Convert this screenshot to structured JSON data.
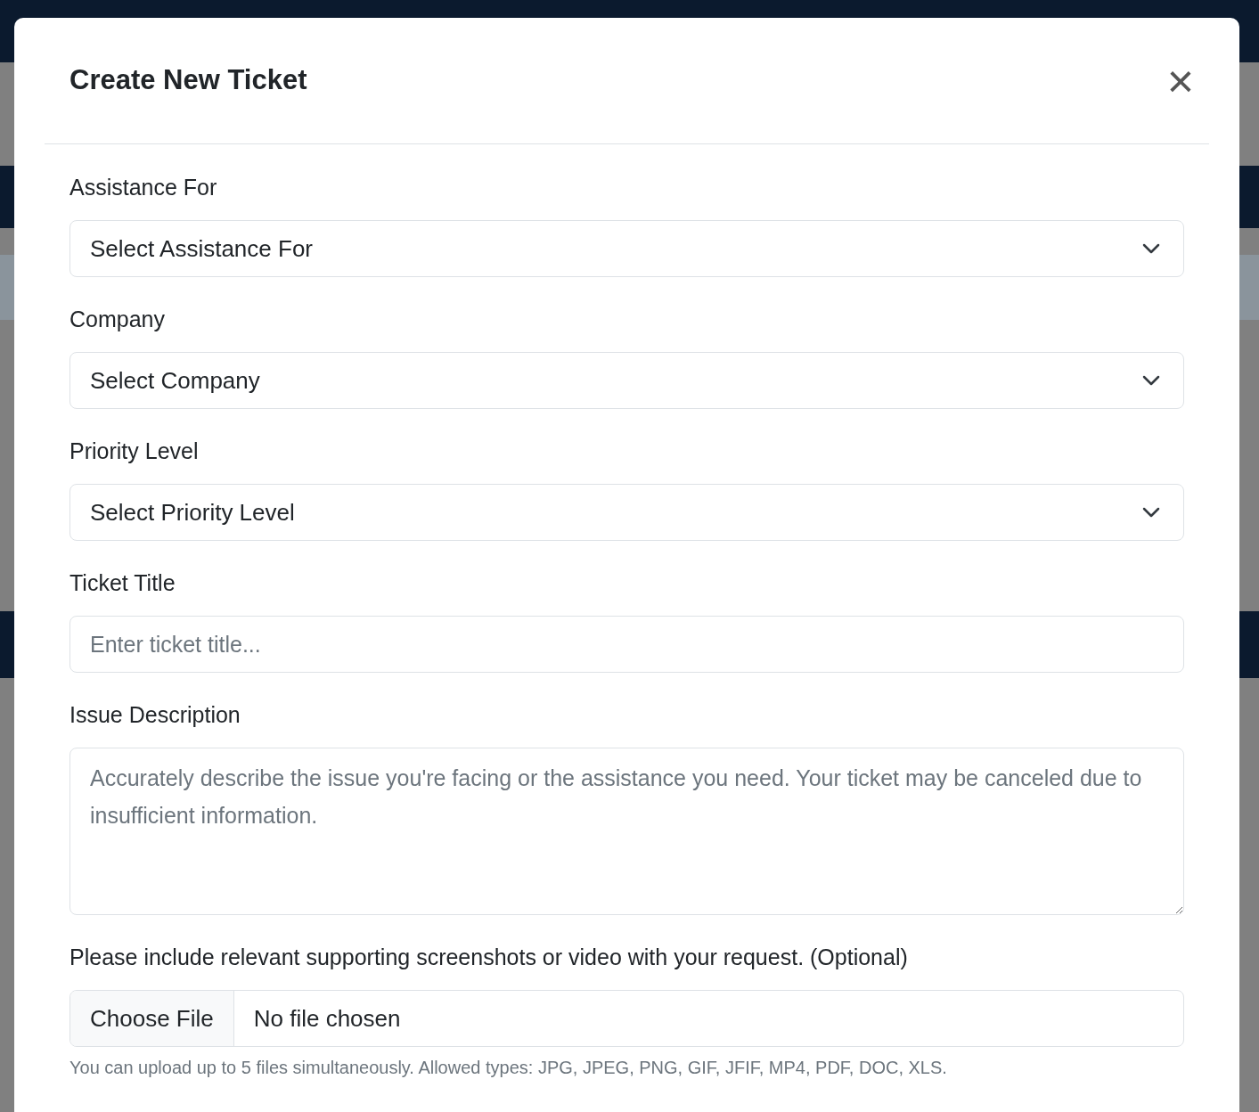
{
  "modal": {
    "title": "Create New Ticket",
    "close_icon": "×"
  },
  "fields": [
    {
      "kind": "select",
      "label": "Assistance For",
      "value": "Select Assistance For"
    },
    {
      "kind": "select",
      "label": "Company",
      "value": "Select Company"
    },
    {
      "kind": "select",
      "label": "Priority Level",
      "value": "Select Priority Level"
    },
    {
      "kind": "text",
      "label": "Ticket Title",
      "placeholder": "Enter ticket title..."
    },
    {
      "kind": "textarea",
      "label": "Issue Description",
      "placeholder": "Accurately describe the issue you're facing or the assistance you need. Your ticket may be canceled due to insufficient information."
    },
    {
      "kind": "file",
      "label": "Please include relevant supporting screenshots or video with your request. (Optional)",
      "button": "Choose File",
      "value": "No file chosen",
      "help": "You can upload up to 5 files simultaneously. Allowed types: JPG, JPEG, PNG, GIF, JFIF, MP4, PDF, DOC, XLS."
    }
  ]
}
